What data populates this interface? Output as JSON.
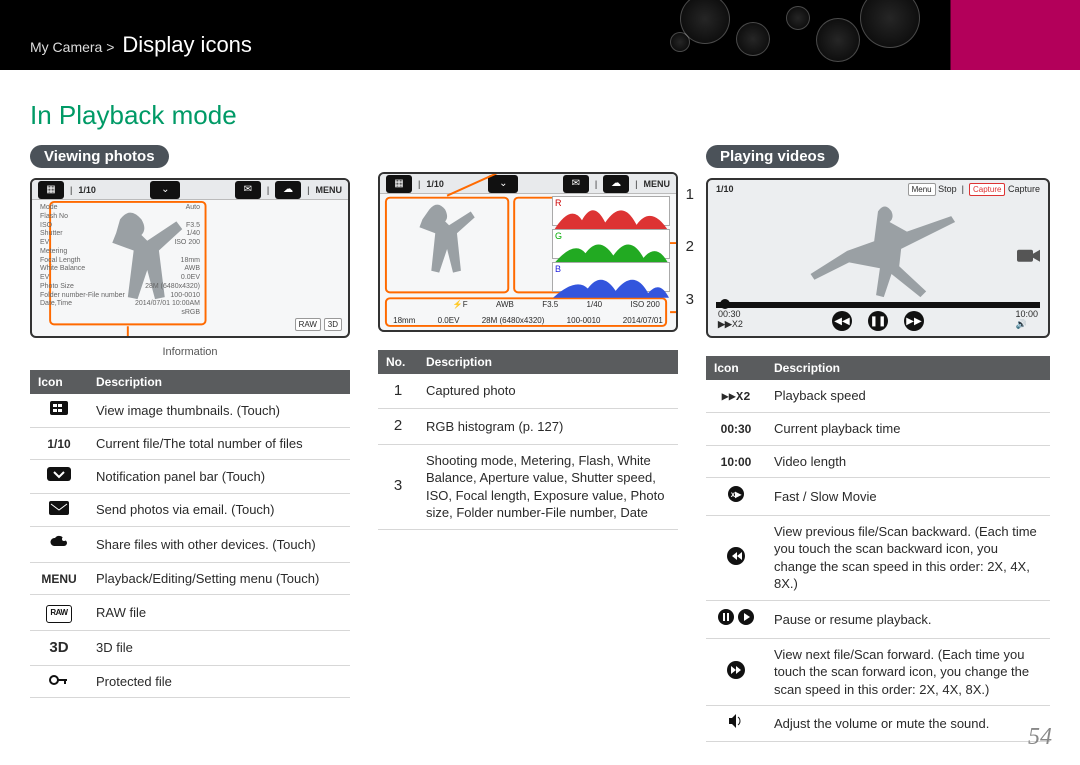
{
  "breadcrumb": {
    "parent": "My Camera >",
    "current": "Display icons"
  },
  "section_heading": "In Playback mode",
  "page_number": "54",
  "photos": {
    "title": "Viewing photos",
    "lcd": {
      "counter": "1/10",
      "menu": "MENU",
      "info_caption": "Information",
      "info_rows": [
        [
          "Mode",
          "Auto"
        ],
        [
          "Flash No",
          ""
        ],
        [
          "ISO",
          "F3.5"
        ],
        [
          "Shutter",
          "1/40"
        ],
        [
          "EV",
          "ISO 200"
        ],
        [
          "Metering",
          ""
        ],
        [
          "Focal Length",
          "18mm"
        ],
        [
          "White Balance",
          "AWB"
        ],
        [
          "EV",
          "0.0EV"
        ],
        [
          "Photo Size",
          "28M (6480x4320)"
        ],
        [
          "Folder number-File number",
          "100-0010"
        ],
        [
          "Date,Time",
          "2014/07/01 10:00AM"
        ],
        [
          "",
          "sRGB"
        ]
      ]
    },
    "table_headers": [
      "Icon",
      "Description"
    ],
    "rows": [
      {
        "icon_svg": "grid",
        "desc": "View image thumbnails. (Touch)"
      },
      {
        "icon_text": "1/10",
        "bold": true,
        "desc": "Current file/The total number of files"
      },
      {
        "icon_svg": "chev-down",
        "desc": "Notification panel bar (Touch)"
      },
      {
        "icon_svg": "mail",
        "desc": "Send photos via email. (Touch)"
      },
      {
        "icon_svg": "cloud-share",
        "desc": "Share files with other devices. (Touch)"
      },
      {
        "icon_text": "MENU",
        "bold": true,
        "desc": "Playback/Editing/Setting menu (Touch)"
      },
      {
        "icon_text": "RAW",
        "outline": true,
        "desc": "RAW file"
      },
      {
        "icon_text": "3D",
        "bold": true,
        "big": true,
        "desc": "3D file"
      },
      {
        "icon_svg": "key",
        "desc": "Protected file"
      }
    ]
  },
  "histogram": {
    "lcd": {
      "counter": "1/10",
      "menu": "MENU",
      "channels": [
        "R",
        "G",
        "B"
      ],
      "bottom": [
        "18mm",
        "0.0EV",
        "28M (6480x4320)",
        "100-0010",
        "2014/07/01"
      ],
      "bottom2": [
        "",
        "",
        "⚡F",
        "AWB",
        "F3.5",
        "1/40",
        "ISO 200"
      ]
    },
    "callouts": [
      "1",
      "2",
      "3"
    ],
    "table_headers": [
      "No.",
      "Description"
    ],
    "rows": [
      {
        "no": "1",
        "desc": "Captured photo"
      },
      {
        "no": "2",
        "desc": "RGB histogram (p. 127)"
      },
      {
        "no": "3",
        "desc": "Shooting mode, Metering, Flash, White Balance, Aperture value, Shutter speed, ISO, Focal length, Exposure value, Photo size, Folder number-File number, Date"
      }
    ]
  },
  "videos": {
    "title": "Playing videos",
    "lcd": {
      "counter": "1/10",
      "stop_btn": "Stop",
      "menu_label": "Menu",
      "capture_btn": "Capture",
      "elapsed": "00:30",
      "total": "10:00",
      "speed_badge": "X2"
    },
    "table_headers": [
      "Icon",
      "Description"
    ],
    "rows": [
      {
        "icon_text": "▶▶X2",
        "mono": true,
        "desc": "Playback speed"
      },
      {
        "icon_text": "00:30",
        "bold": true,
        "desc": "Current playback time"
      },
      {
        "icon_text": "10:00",
        "bold": true,
        "desc": "Video length"
      },
      {
        "icon_svg": "fast-slow",
        "desc": "Fast / Slow Movie"
      },
      {
        "icon_svg": "rew",
        "desc": "View previous file/Scan backward. (Each time you touch the scan backward icon, you change the scan speed in this order: 2X, 4X, 8X.)"
      },
      {
        "icon_svg": "pause-play",
        "desc": "Pause or resume playback."
      },
      {
        "icon_svg": "ffwd",
        "desc": "View next file/Scan forward. (Each time you touch the scan forward icon, you change the scan speed in this order: 2X, 4X, 8X.)"
      },
      {
        "icon_svg": "speaker",
        "desc": "Adjust the volume or mute the sound."
      }
    ]
  }
}
